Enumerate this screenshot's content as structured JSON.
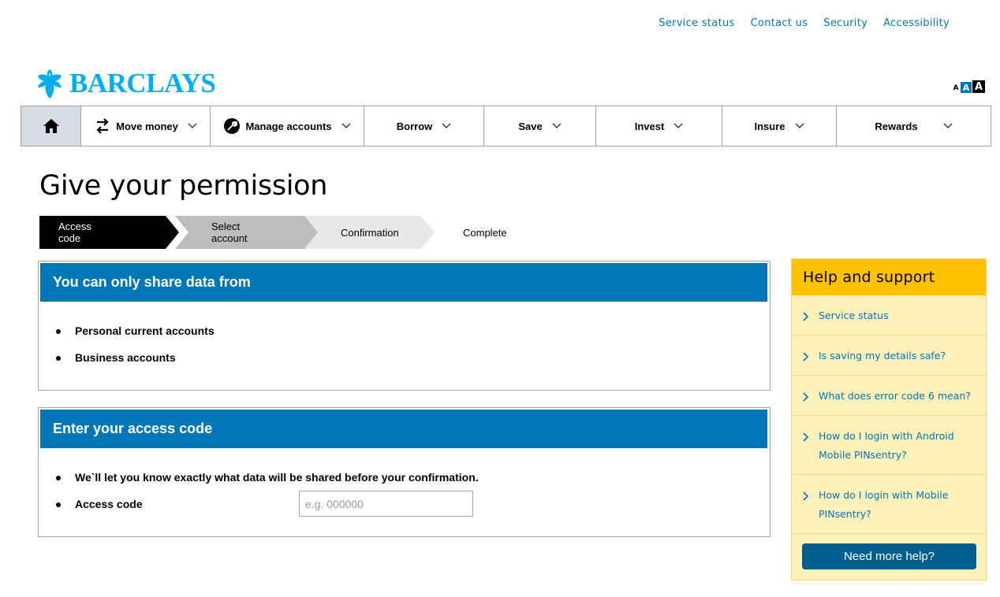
{
  "top_links": [
    "Service status",
    "Contact us",
    "Security",
    "Accessibility"
  ],
  "brand": {
    "name": "BARCLAYS",
    "color": "#00aeef"
  },
  "text_size": {
    "small": "A",
    "medium": "A",
    "large": "A"
  },
  "nav": {
    "home_icon": "home-icon",
    "items": [
      {
        "label": "Move money",
        "icon": "transfer-arrows-icon"
      },
      {
        "label": "Manage accounts",
        "icon": "wrench-circle-icon"
      },
      {
        "label": "Borrow"
      },
      {
        "label": "Save"
      },
      {
        "label": "Invest"
      },
      {
        "label": "Insure"
      },
      {
        "label": "Rewards"
      }
    ]
  },
  "page_title": "Give your permission",
  "steps": [
    {
      "label": "Access code",
      "state": "active"
    },
    {
      "label": "Select account",
      "state": "upcoming"
    },
    {
      "label": "Confirmation",
      "state": "upcoming"
    },
    {
      "label": "Complete",
      "state": "upcoming"
    }
  ],
  "share_panel": {
    "title": "You can only share data from",
    "items": [
      "Personal current accounts",
      "Business accounts"
    ]
  },
  "access_panel": {
    "title": "Enter your access code",
    "note": "We`ll let you know exactly what data will be shared before your confirmation.",
    "field_label": "Access code",
    "field_value": "",
    "field_placeholder": "e.g. 000000"
  },
  "help": {
    "title": "Help and support",
    "items": [
      "Service status",
      "Is saving my details safe?",
      "What does error code 6 mean?",
      "How do I login with Android Mobile PINsentry?",
      "How do I login with Mobile PINsentry?"
    ],
    "button": "Need more help?"
  },
  "colors": {
    "primary_blue": "#0076b6",
    "help_header": "#ffc000",
    "help_bg": "#fdf0b8",
    "home_tab_bg": "#d7dbe6",
    "button_dark_blue": "#005e8e"
  }
}
